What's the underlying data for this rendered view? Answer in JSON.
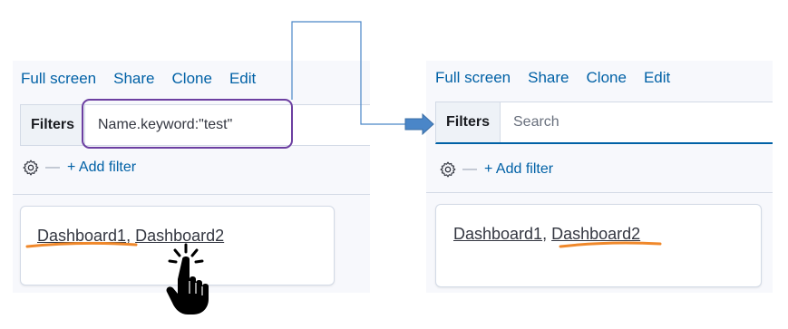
{
  "left": {
    "toolbar": [
      "Full screen",
      "Share",
      "Clone",
      "Edit"
    ],
    "filters_label": "Filters",
    "query_value": "Name.keyword:\"test\"",
    "add_filter": "+ Add filter",
    "dashboard_links": [
      "Dashboard1",
      "Dashboard2"
    ],
    "separator": ", "
  },
  "right": {
    "toolbar": [
      "Full screen",
      "Share",
      "Clone",
      "Edit"
    ],
    "filters_label": "Filters",
    "search_placeholder": "Search",
    "add_filter": "+ Add filter",
    "dashboard_links": [
      "Dashboard1",
      "Dashboard2"
    ],
    "separator": ", "
  },
  "colors": {
    "link": "#0061a6",
    "highlight_box": "#6c3fa1",
    "underline_mark": "#f0882a",
    "arrow": "#4a86c8"
  },
  "icons": {
    "settings": "gear-icon",
    "pointer": "hand-pointer-icon",
    "arrow": "right-arrow-icon"
  }
}
